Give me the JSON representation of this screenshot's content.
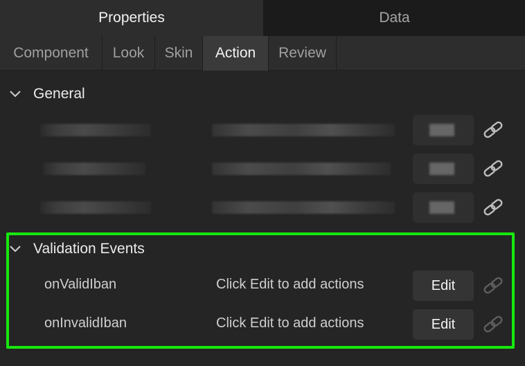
{
  "top_tabs": [
    {
      "label": "Properties",
      "active": true
    },
    {
      "label": "Data",
      "active": false
    }
  ],
  "sub_tabs": [
    {
      "label": "Component",
      "active": false
    },
    {
      "label": "Look",
      "active": false
    },
    {
      "label": "Skin",
      "active": false
    },
    {
      "label": "Action",
      "active": true
    },
    {
      "label": "Review",
      "active": false
    }
  ],
  "sections": {
    "general": {
      "title": "General"
    },
    "validation": {
      "title": "Validation Events",
      "rows": [
        {
          "name": "onValidIban",
          "hint": "Click Edit to add actions",
          "button": "Edit"
        },
        {
          "name": "onInvalidIban",
          "hint": "Click Edit to add actions",
          "button": "Edit"
        }
      ]
    }
  },
  "icons": {
    "chevron": "chevron-down-icon",
    "link": "link-icon"
  },
  "colors": {
    "highlight": "#17e80e",
    "background": "#252525",
    "active_tab": "#2d2d2d",
    "button": "#343434"
  }
}
